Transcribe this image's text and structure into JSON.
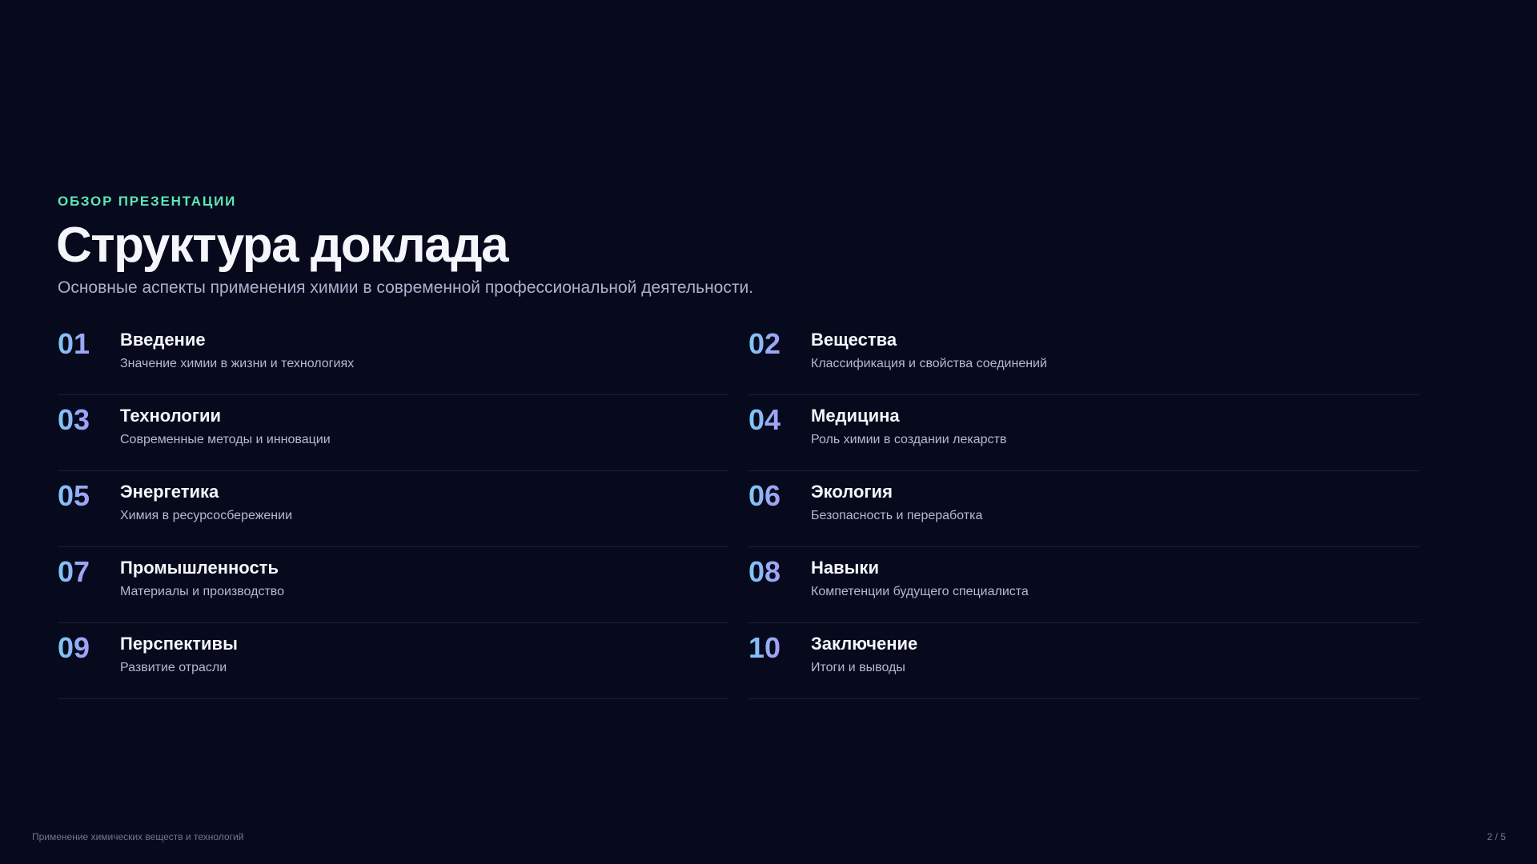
{
  "header": {
    "eyebrow": "ОБЗОР ПРЕЗЕНТАЦИИ",
    "title": "Структура доклада",
    "subtitle": "Основные аспекты применения химии в современной профессиональной деятельности."
  },
  "items": [
    {
      "num": "01",
      "title": "Введение",
      "desc": "Значение химии в жизни и технологиях"
    },
    {
      "num": "02",
      "title": "Вещества",
      "desc": "Классификация и свойства соединений"
    },
    {
      "num": "03",
      "title": "Технологии",
      "desc": "Современные методы и инновации"
    },
    {
      "num": "04",
      "title": "Медицина",
      "desc": "Роль химии в создании лекарств"
    },
    {
      "num": "05",
      "title": "Энергетика",
      "desc": "Химия в ресурсосбережении"
    },
    {
      "num": "06",
      "title": "Экология",
      "desc": "Безопасность и переработка"
    },
    {
      "num": "07",
      "title": "Промышленность",
      "desc": "Материалы и производство"
    },
    {
      "num": "08",
      "title": "Навыки",
      "desc": "Компетенции будущего специалиста"
    },
    {
      "num": "09",
      "title": "Перспективы",
      "desc": "Развитие отрасли"
    },
    {
      "num": "10",
      "title": "Заключение",
      "desc": "Итоги и выводы"
    }
  ],
  "footer": {
    "left": "Применение химических веществ и технологий",
    "page": "2 / 5"
  },
  "colors": {
    "background": "#060a1c",
    "accent": "#5ee6b8",
    "number_gradient_start": "#7cc9f4",
    "number_gradient_end": "#a59cf6"
  }
}
